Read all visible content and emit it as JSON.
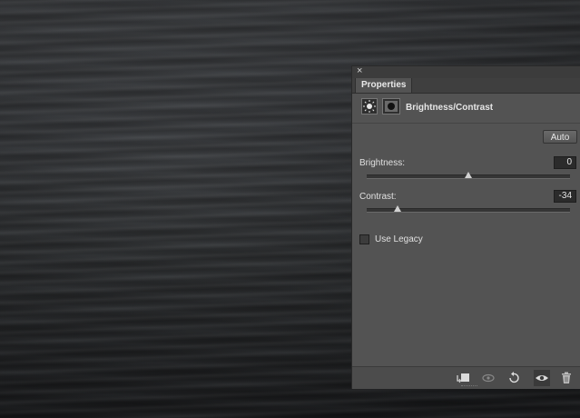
{
  "panel": {
    "close_symbol": "×",
    "tab_label": "Properties",
    "adjustment_title": "Brightness/Contrast",
    "auto_label": "Auto",
    "brightness": {
      "label": "Brightness:",
      "value": "0",
      "slider_fraction": 0.5
    },
    "contrast": {
      "label": "Contrast:",
      "value": "-34",
      "slider_fraction": 0.15
    },
    "use_legacy_label": "Use Legacy",
    "use_legacy_checked": false
  },
  "icons": {
    "adjustment": "sun-icon",
    "mask": "layer-mask-icon",
    "clip": "clip-to-layer-icon",
    "view_previous": "view-previous-state-icon",
    "reset": "reset-icon",
    "visibility": "eye-icon",
    "delete": "trash-icon"
  }
}
